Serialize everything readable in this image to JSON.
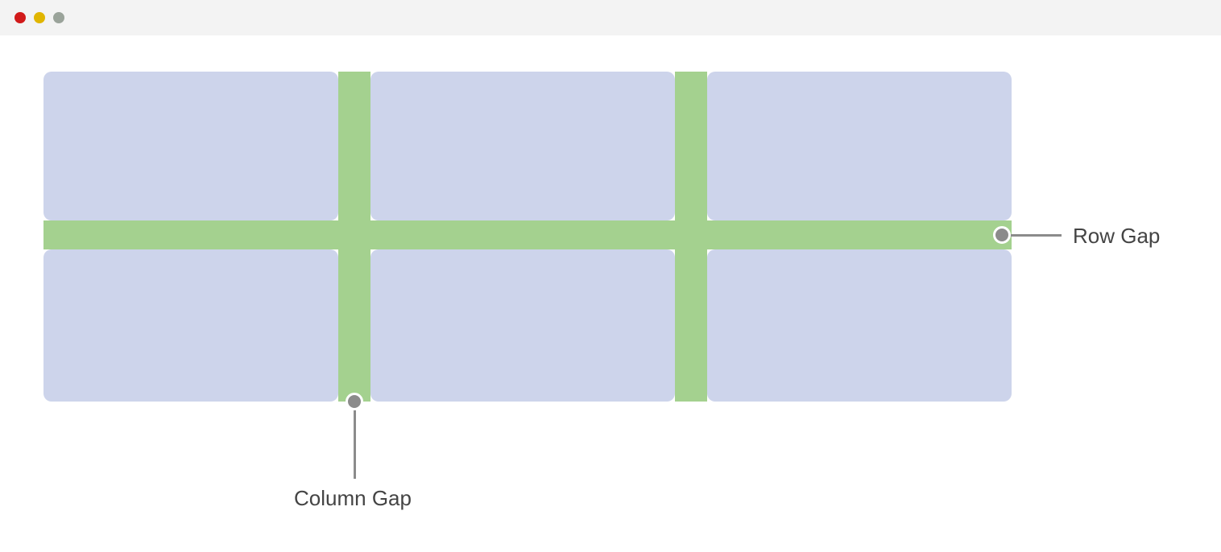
{
  "colors": {
    "titlebar_bg": "#f3f3f3",
    "tile_fill": "#cdd4eb",
    "gap_fill": "#a4d18f",
    "callout_gray": "#8b8b8b",
    "label_text": "#444444"
  },
  "labels": {
    "row_gap": "Row Gap",
    "column_gap": "Column Gap"
  }
}
